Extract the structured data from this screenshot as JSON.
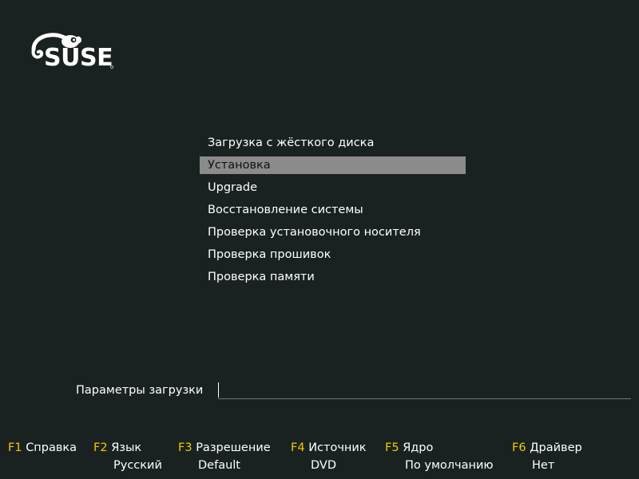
{
  "logo": {
    "text": "SUSE"
  },
  "menu": {
    "items": [
      {
        "label": "Загрузка с жёсткого диска",
        "selected": false
      },
      {
        "label": "Установка",
        "selected": true
      },
      {
        "label": "Upgrade",
        "selected": false
      },
      {
        "label": "Восстановление системы",
        "selected": false
      },
      {
        "label": "Проверка установочного носителя",
        "selected": false
      },
      {
        "label": "Проверка прошивок",
        "selected": false
      },
      {
        "label": "Проверка памяти",
        "selected": false
      }
    ]
  },
  "boot_options": {
    "label": "Параметры загрузки",
    "value": ""
  },
  "function_keys": [
    {
      "key": "F1",
      "name": "Справка",
      "value": ""
    },
    {
      "key": "F2",
      "name": "Язык",
      "value": "Русский"
    },
    {
      "key": "F3",
      "name": "Разрешение",
      "value": "Default"
    },
    {
      "key": "F4",
      "name": "Источник",
      "value": "DVD"
    },
    {
      "key": "F5",
      "name": "Ядро",
      "value": "По умолчанию"
    },
    {
      "key": "F6",
      "name": "Драйвер",
      "value": "Нет"
    }
  ],
  "colors": {
    "background": "#1a2221",
    "selection": "#8b8b8b",
    "function_key": "#f0c800",
    "text": "#ffffff"
  }
}
